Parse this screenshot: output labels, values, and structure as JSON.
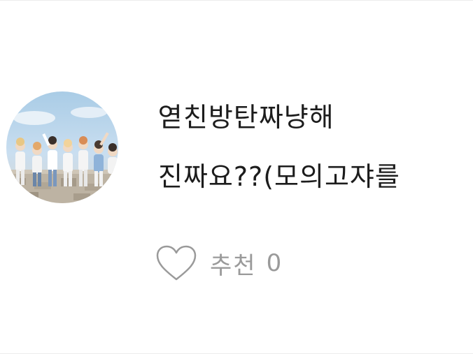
{
  "post": {
    "avatar_icon": "group-photo-avatar",
    "title_line1": "엳친방탄짜냥해",
    "title_line2": "진짜요??(모의고쟈를"
  },
  "like": {
    "icon": "heart-outline-icon",
    "label": "추천",
    "count": "0",
    "icon_color": "#9a9a9a"
  }
}
